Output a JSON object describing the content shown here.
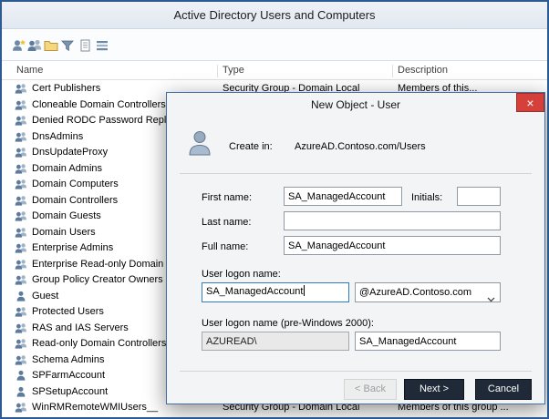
{
  "window": {
    "title": "Active Directory Users and Computers"
  },
  "colors": {
    "window_border": "#2d5a91",
    "close_button_red": "#d6403a",
    "dark_button": "#1f2937",
    "focused_field_border": "#2f7cc2"
  },
  "toolbar": {
    "icons": [
      "new-user-icon",
      "new-group-icon",
      "new-ou-icon",
      "filter-icon",
      "export-list-icon",
      "view-columns-icon"
    ]
  },
  "list": {
    "columns": [
      "Name",
      "Type",
      "Description"
    ],
    "items": [
      {
        "name": "Cert Publishers",
        "icon": "group",
        "type": "Security Group - Domain Local",
        "desc": "Members of this..."
      },
      {
        "name": "Cloneable Domain Controllers",
        "icon": "group"
      },
      {
        "name": "Denied RODC Password Replicati...",
        "icon": "group"
      },
      {
        "name": "DnsAdmins",
        "icon": "group"
      },
      {
        "name": "DnsUpdateProxy",
        "icon": "group"
      },
      {
        "name": "Domain Admins",
        "icon": "group"
      },
      {
        "name": "Domain Computers",
        "icon": "group"
      },
      {
        "name": "Domain Controllers",
        "icon": "group"
      },
      {
        "name": "Domain Guests",
        "icon": "group"
      },
      {
        "name": "Domain Users",
        "icon": "group"
      },
      {
        "name": "Enterprise Admins",
        "icon": "group"
      },
      {
        "name": "Enterprise Read-only Domain Con...",
        "icon": "group"
      },
      {
        "name": "Group Policy Creator Owners",
        "icon": "group"
      },
      {
        "name": "Guest",
        "icon": "user"
      },
      {
        "name": "Protected Users",
        "icon": "group"
      },
      {
        "name": "RAS and IAS Servers",
        "icon": "group"
      },
      {
        "name": "Read-only Domain Controllers",
        "icon": "group"
      },
      {
        "name": "Schema Admins",
        "icon": "group"
      },
      {
        "name": "SPFarmAccount",
        "icon": "user"
      },
      {
        "name": "SPSetupAccount",
        "icon": "user"
      },
      {
        "name": "WinRMRemoteWMIUsers__",
        "icon": "group",
        "type": "Security Group - Domain Local",
        "desc": "Members of this group ..."
      }
    ]
  },
  "dialog": {
    "title": "New Object - User",
    "close_glyph": "×",
    "create_in_label": "Create in:",
    "create_in_value": "AzureAD.Contoso.com/Users",
    "fields": {
      "first_name_label": "First name:",
      "first_name_value": "SA_ManagedAccount",
      "initials_label": "Initials:",
      "initials_value": "",
      "last_name_label": "Last name:",
      "last_name_value": "",
      "full_name_label": "Full name:",
      "full_name_value": "SA_ManagedAccount",
      "logon_label": "User logon name:",
      "logon_value": "SA_ManagedAccount",
      "logon_domain": "@AzureAD.Contoso.com",
      "pre2000_label": "User logon name (pre-Windows 2000):",
      "pre2000_domain": "AZUREAD\\",
      "pre2000_value": "SA_ManagedAccount"
    },
    "buttons": {
      "back": "< Back",
      "next": "Next >",
      "cancel": "Cancel"
    }
  }
}
